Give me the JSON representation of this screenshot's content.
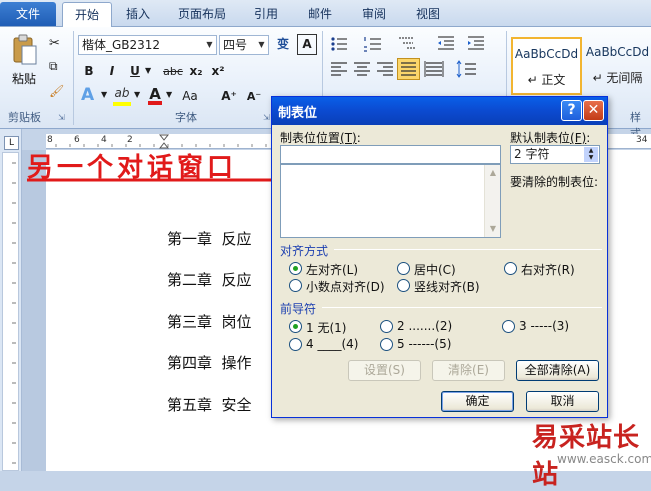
{
  "tabs": [
    "文件",
    "开始",
    "插入",
    "页面布局",
    "引用",
    "邮件",
    "审阅",
    "视图"
  ],
  "ribbon": {
    "clipboard": {
      "paste_label": "粘贴",
      "group_label": "剪贴板"
    },
    "font": {
      "font_name": "楷体_GB2312",
      "font_size": "四号",
      "group_label": "字体",
      "bold": "B",
      "italic": "I",
      "underline": "U",
      "strike": "abc",
      "subscript": "x₂",
      "superscript": "x²",
      "wen": "变",
      "border_a": "A",
      "grow": "A⁺",
      "shrink": "A⁻",
      "aa": "Aa"
    },
    "styles": {
      "items": [
        {
          "sample": "AaBbCcDd",
          "name": "↵ 正文"
        },
        {
          "sample": "AaBbCcDd",
          "name": "↵ 无间隔"
        }
      ],
      "group_label": "样式"
    }
  },
  "ruler_ticks": [
    "8",
    "6",
    "4",
    "2",
    "34"
  ],
  "document": {
    "lines": [
      "第一章  反应",
      "第二章  反应",
      "第三章  岗位",
      "第四章  操作",
      "第五章  安全"
    ]
  },
  "annotation": "另一个对话窗口",
  "dialog": {
    "title": "制表位",
    "help": "?",
    "close": "✕",
    "tab_position_label": "制表位位置",
    "tab_position_key": "(T)",
    "tab_position_value": "",
    "default_label": "默认制表位",
    "default_key": "(F)",
    "default_value": "2 字符",
    "clear_label": "要清除的制表位:",
    "alignment": {
      "title": "对齐方式",
      "options": [
        "左对齐(L)",
        "居中(C)",
        "右对齐(R)",
        "小数点对齐(D)",
        "竖线对齐(B)"
      ],
      "selected": "左对齐(L)"
    },
    "leader": {
      "title": "前导符",
      "options": [
        "1 无(1)",
        "2 .......(2)",
        "3 -----(3)",
        "4 ____(4)",
        "5 ------(5)"
      ],
      "selected": "1 无(1)"
    },
    "buttons": {
      "set": "设置(S)",
      "clear": "清除(E)",
      "clear_all": "全部清除(A)",
      "ok": "确定",
      "cancel": "取消"
    }
  },
  "watermark": {
    "title": "易采站长站",
    "url": "www.easck.com"
  }
}
